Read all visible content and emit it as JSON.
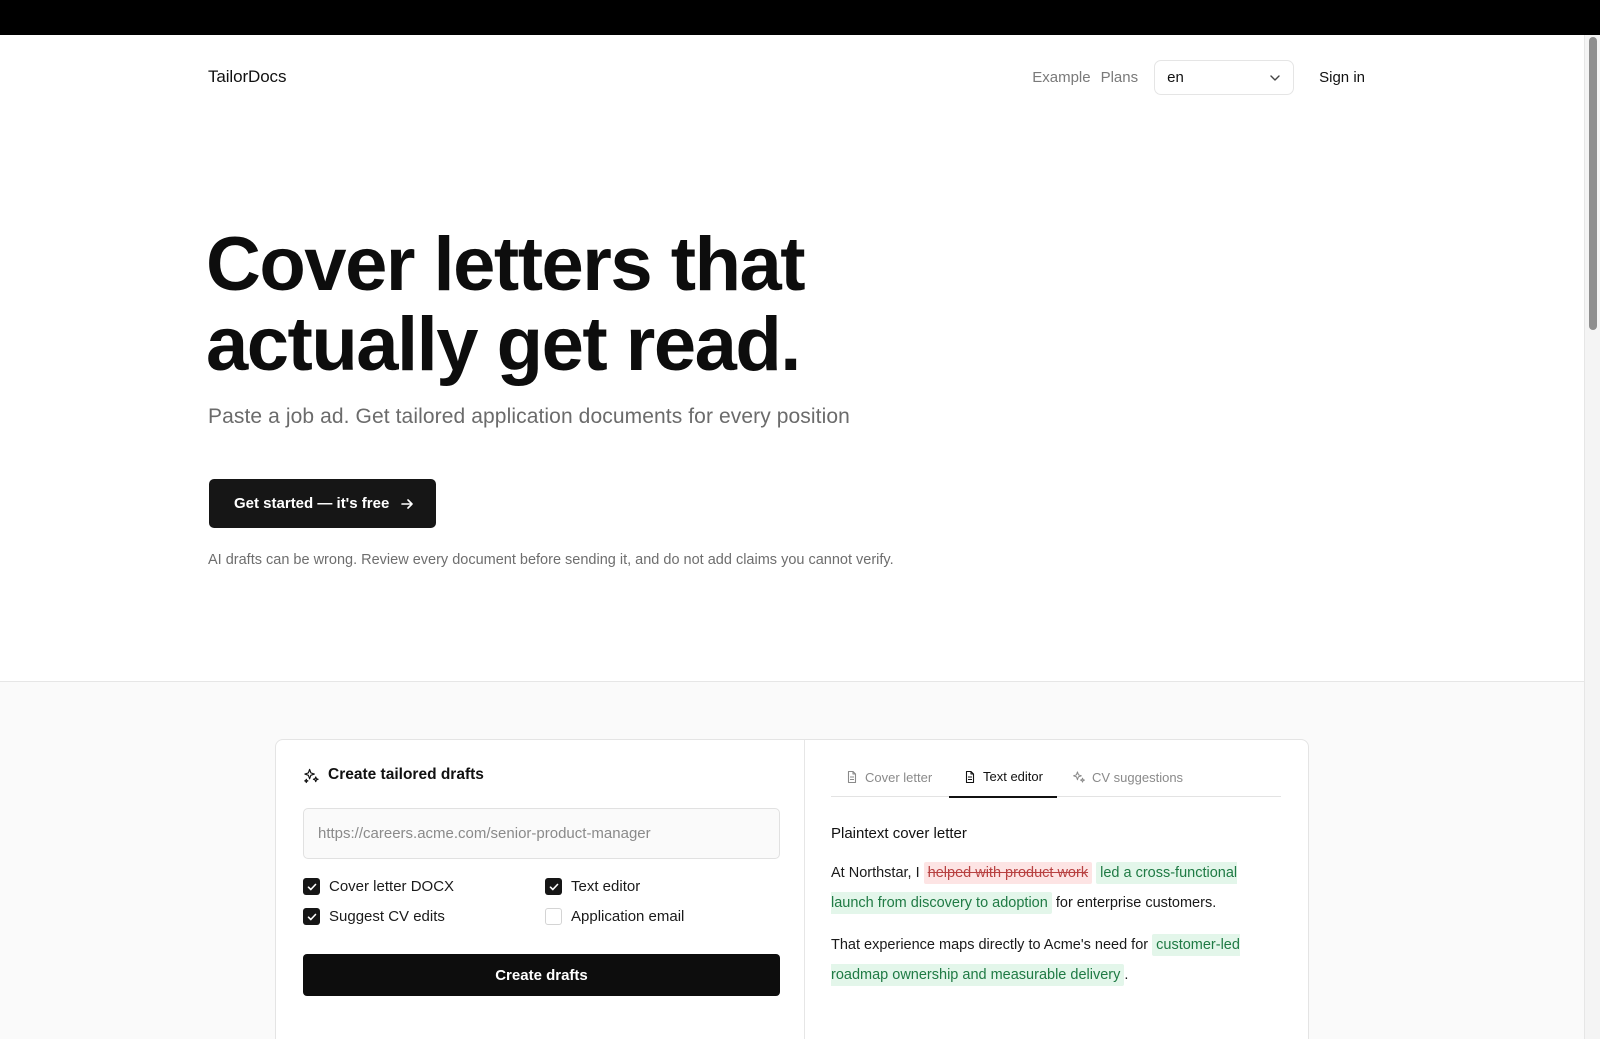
{
  "header": {
    "brand": "TailorDocs",
    "nav": {
      "example": "Example",
      "plans": "Plans",
      "sign_in": "Sign in"
    },
    "language": {
      "selected": "en"
    }
  },
  "hero": {
    "title_line1": "Cover letters that",
    "title_line2": "actually get read.",
    "subtitle": "Paste a job ad. Get tailored application documents for every position",
    "cta_label": "Get started — it's free",
    "disclaimer": "AI drafts can be wrong. Review every document before sending it, and do not add claims you cannot verify."
  },
  "form": {
    "title": "Create tailored drafts",
    "url_placeholder": "https://careers.acme.com/senior-product-manager",
    "options": [
      {
        "label": "Cover letter DOCX",
        "checked": true
      },
      {
        "label": "Text editor",
        "checked": true
      },
      {
        "label": "Suggest CV edits",
        "checked": true
      },
      {
        "label": "Application email",
        "checked": false
      }
    ],
    "submit_label": "Create drafts"
  },
  "preview": {
    "tabs": [
      {
        "label": "Cover letter",
        "icon": "document-icon",
        "active": false
      },
      {
        "label": "Text editor",
        "icon": "document-icon",
        "active": true
      },
      {
        "label": "CV suggestions",
        "icon": "sparkle-icon",
        "active": false
      }
    ],
    "title": "Plaintext cover letter",
    "para1": {
      "before": "At Northstar, I ",
      "deleted": "helped with product work",
      "inserted": "led a cross-functional launch from discovery to adoption",
      "after": " for enterprise customers."
    },
    "para2": {
      "before": "That experience maps directly to Acme's need for ",
      "inserted": "customer-led roadmap ownership and measurable delivery",
      "after": "."
    }
  }
}
